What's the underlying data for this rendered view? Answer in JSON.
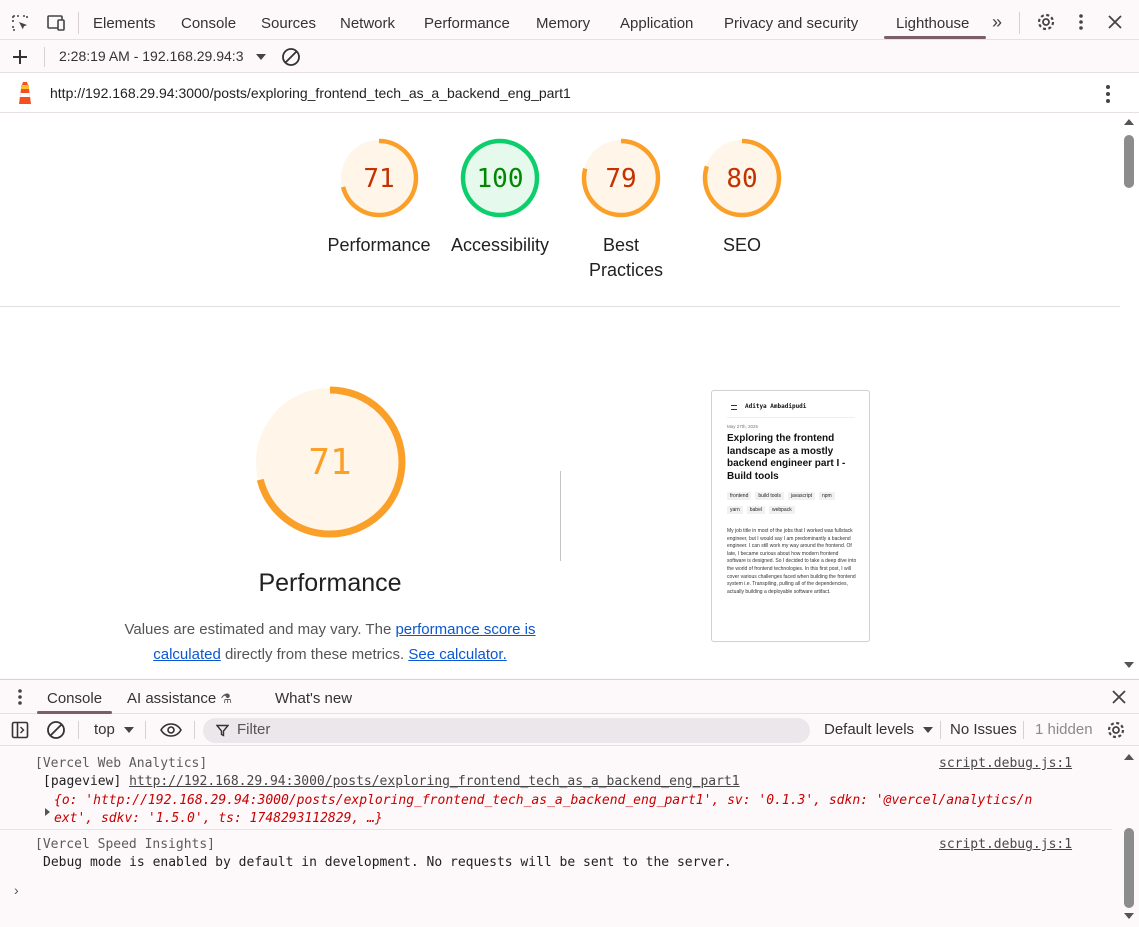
{
  "tabs": [
    {
      "label": "Elements"
    },
    {
      "label": "Console"
    },
    {
      "label": "Sources"
    },
    {
      "label": "Network"
    },
    {
      "label": "Performance"
    },
    {
      "label": "Memory"
    },
    {
      "label": "Application"
    },
    {
      "label": "Privacy and security"
    },
    {
      "label": "Lighthouse",
      "active": true
    }
  ],
  "lighthouse_toolbar": {
    "report_select": "2:28:19 AM - 192.168.29.94:3"
  },
  "url_bar": {
    "url": "http://192.168.29.94:3000/posts/exploring_frontend_tech_as_a_backend_eng_part1"
  },
  "gauges": [
    {
      "score": "71",
      "label": "Performance",
      "value": 71,
      "status": "average"
    },
    {
      "score": "100",
      "label": "Accessibility",
      "value": 100,
      "status": "pass"
    },
    {
      "score": "79",
      "label": "Best Practices",
      "value": 79,
      "status": "average"
    },
    {
      "score": "80",
      "label": "SEO",
      "value": 80,
      "status": "average"
    }
  ],
  "performance_section": {
    "score": "71",
    "value": 71,
    "title": "Performance",
    "desc_prefix": "Values are estimated and may vary. The ",
    "link1": "performance score is calculated",
    "desc_mid": " directly from these metrics. ",
    "link2": "See calculator."
  },
  "screenshot_preview": {
    "author": "Aditya Ambadipudi",
    "date": "May 27th, 2025",
    "title": "Exploring the frontend landscape as a mostly backend engineer part I - Build tools",
    "tags": [
      "frontend",
      "build tools",
      "javascript",
      "npm",
      "yarn",
      "babel",
      "webpack"
    ],
    "body": "My job title in most of the jobs that I worked was fullstack engineer, but I would say I am predominantly a backend engineer. I can still work my way around the frontend. Of late, I became curious about how modern frontend software is designed. So I decided to take a deep dive into the world of frontend technologies. In this first post, I will cover various challenges faced when building the frontend system i.e. Transpiling, pulling all of the dependencies, actually building a deployable software artifact."
  },
  "drawer": {
    "tabs": [
      {
        "label": "Console",
        "active": true
      },
      {
        "label": "AI assistance"
      },
      {
        "label": "What's new"
      }
    ]
  },
  "console_toolbar": {
    "context": "top",
    "filter_placeholder": "Filter",
    "levels": "Default levels",
    "issues": "No Issues",
    "hidden": "1 hidden"
  },
  "console_messages": [
    {
      "header": "[Vercel Web Analytics]",
      "source": "script.debug.js:1",
      "line2_prefix": "[pageview] ",
      "line2_link": "http://192.168.29.94:3000/posts/exploring_frontend_tech_as_a_backend_eng_part1",
      "object_line1": "{o: 'http://192.168.29.94:3000/posts/exploring_frontend_tech_as_a_backend_eng_part1', sv: '0.1.3', sdkn: '@vercel/analytics/n",
      "object_line2": "ext', sdkv: '1.5.0', ts: 1748293112829, …}"
    },
    {
      "header": "[Vercel Speed Insights]",
      "source": "script.debug.js:1",
      "line2": "Debug mode is enabled by default in development. No requests will be sent to the server."
    }
  ],
  "colors": {
    "average": "#fa9f27",
    "average_text": "#c33300",
    "average_bg": "#fff5e8",
    "pass": "#0cce6b",
    "pass_text": "#008800",
    "pass_bg": "#e5f9ed"
  }
}
